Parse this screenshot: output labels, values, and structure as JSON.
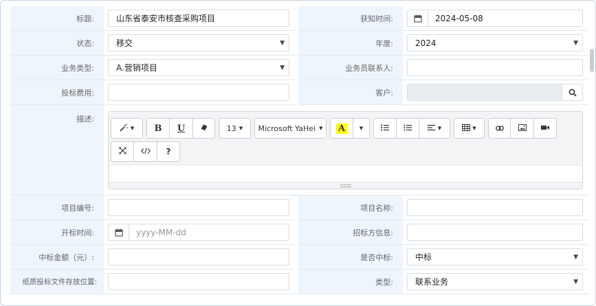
{
  "form": {
    "title": {
      "label": "标题:",
      "value": "山东省泰安市核查采购项目"
    },
    "notify_time": {
      "label": "获知时间:",
      "value": "2024-05-08",
      "icon": "calendar-icon"
    },
    "status": {
      "label": "状态:",
      "value": "移交"
    },
    "year": {
      "label": "年度:",
      "value": "2024"
    },
    "biz_type": {
      "label": "业务类型:",
      "value": "A.营销项目"
    },
    "biz_contact": {
      "label": "业务员联系人:",
      "value": ""
    },
    "bid_fee": {
      "label": "投标费用:",
      "value": ""
    },
    "customer": {
      "label": "客户:",
      "value": "",
      "icon": "search-icon"
    },
    "description": {
      "label": "描述:"
    },
    "project_no": {
      "label": "项目编号:",
      "value": ""
    },
    "project_name": {
      "label": "项目名称:",
      "value": ""
    },
    "open_time": {
      "label": "开标时间:",
      "placeholder": "yyyy-MM-dd",
      "icon": "calendar-icon"
    },
    "tenderer_info": {
      "label": "招标方信息:",
      "value": ""
    },
    "win_amount": {
      "label": "中标金额（元）:",
      "value": ""
    },
    "is_win": {
      "label": "是否中标:",
      "value": "中标"
    },
    "paper_location": {
      "label": "纸质投标文件存放位置:",
      "value": ""
    },
    "type": {
      "label": "类型:",
      "value": "联系业务"
    }
  },
  "editor": {
    "font_size": "13",
    "font_name": "Microsoft YaHei",
    "bold": "B",
    "underline": "U",
    "help": "?",
    "highlight_letter": "A",
    "colors": {
      "highlight": "#ffff00",
      "label_bg": "#eef5fc",
      "border": "#d6dde5"
    }
  }
}
